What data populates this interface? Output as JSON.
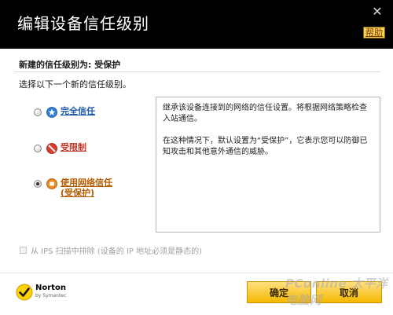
{
  "window": {
    "title": "编辑设备信任级别",
    "close_glyph": "✕",
    "help_label": "帮助"
  },
  "main": {
    "new_level_heading": "新建的信任级别为: 受保护",
    "instruction": "选择以下一个新的信任级别。",
    "options": [
      {
        "label_lines": [
          "完全信任"
        ],
        "icon": "shield-star-icon",
        "checked": false,
        "color": "#1e5aa8"
      },
      {
        "label_lines": [
          "受限制"
        ],
        "icon": "no-entry-icon",
        "checked": false,
        "color": "#c0392b"
      },
      {
        "label_lines": [
          "使用网络信任",
          "(受保护)"
        ],
        "icon": "network-trust-icon",
        "checked": true,
        "color": "#b85c00"
      }
    ],
    "description": {
      "para1": "继承该设备连接到的网络的信任设置。将根据网络策略检查入站通信。",
      "para2": "在这种情况下，默认设置为“受保护”，它表示您可以防御已知攻击和其他意外通信的威胁。"
    },
    "exclude_checkbox": {
      "label": "从 IPS 扫描中排除 (设备的 IP 地址必须是静态的)",
      "checked": false,
      "enabled": false
    }
  },
  "footer": {
    "brand_name": "Norton",
    "brand_sub": "by Symantec",
    "ok_label": "确定",
    "cancel_label": "取消",
    "watermark": "PConline 太平洋电脑网"
  },
  "colors": {
    "titlebar": "#000000",
    "button_gradient_top": "#ffe082",
    "button_gradient_bottom": "#f5b800",
    "help_bg": "#f6d05a"
  }
}
